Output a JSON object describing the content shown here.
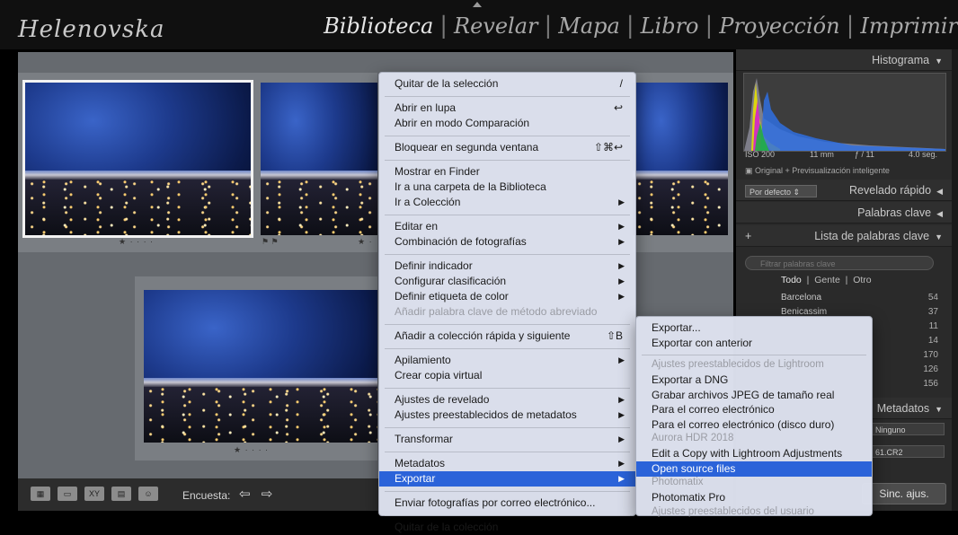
{
  "app": {
    "brand": "Helenovska",
    "modules": [
      "Biblioteca",
      "Revelar",
      "Mapa",
      "Libro",
      "Proyección",
      "Imprimir"
    ],
    "active_module": "Biblioteca"
  },
  "grid": {
    "photos": [
      {
        "rating": "★ · · · ·",
        "selected": true
      },
      {
        "flags": "⚑ ⚑",
        "rating": ""
      },
      {
        "rating": "★ · · · ·"
      },
      {
        "rating": "★ · · · ·"
      }
    ]
  },
  "toolbar": {
    "survey_label": "Encuesta:",
    "prev_next": "⇦ ⇨",
    "view_icons": [
      "▦",
      "▭",
      "XY",
      "▤",
      "☺"
    ]
  },
  "right_panel": {
    "histogram": {
      "title": "Histograma",
      "iso": "ISO 200",
      "focal": "11 mm",
      "aperture": "ƒ / 11",
      "shutter": "4.0 seg.",
      "original_preview": "Original + Previsualización inteligente"
    },
    "quick_develop": {
      "preset": "Por defecto",
      "title": "Revelado rápido"
    },
    "keywording_title": "Palabras clave",
    "keyword_list": {
      "title": "Lista de palabras clave",
      "add": "+",
      "filter_placeholder": "Filtrar palabras clave",
      "tabs": [
        "Todo",
        "Gente",
        "Otro"
      ],
      "rows": [
        {
          "name": "Barcelona",
          "count": "54"
        },
        {
          "name": "Benicassim",
          "count": "37"
        },
        {
          "name": "",
          "count": "11"
        },
        {
          "name": "",
          "count": "14"
        },
        {
          "name": "",
          "count": "170"
        },
        {
          "name": "",
          "count": "126"
        },
        {
          "name": "",
          "count": "156"
        }
      ]
    },
    "metadata": {
      "title": "Metadatos",
      "preset": "Ninguno",
      "file": "61.CR2"
    },
    "sync_button": "Sinc. ajus."
  },
  "context_menu": {
    "items": [
      {
        "label": "Quitar de la selección",
        "shortcut": "/"
      },
      {
        "sep": true
      },
      {
        "label": "Abrir en lupa",
        "shortcut": "↩"
      },
      {
        "label": "Abrir en modo Comparación"
      },
      {
        "sep": true
      },
      {
        "label": "Bloquear en segunda ventana",
        "shortcut": "⇧⌘↩"
      },
      {
        "sep": true
      },
      {
        "label": "Mostrar en Finder"
      },
      {
        "label": "Ir a una carpeta de la Biblioteca"
      },
      {
        "label": "Ir a Colección",
        "submenu": true
      },
      {
        "sep": true
      },
      {
        "label": "Editar en",
        "submenu": true
      },
      {
        "label": "Combinación de fotografías",
        "submenu": true
      },
      {
        "sep": true
      },
      {
        "label": "Definir indicador",
        "submenu": true
      },
      {
        "label": "Configurar clasificación",
        "submenu": true
      },
      {
        "label": "Definir etiqueta de color",
        "submenu": true
      },
      {
        "label": "Añadir palabra clave de método abreviado",
        "disabled": true
      },
      {
        "sep": true
      },
      {
        "label": "Añadir a colección rápida y siguiente",
        "shortcut": "⇧B"
      },
      {
        "sep": true
      },
      {
        "label": "Apilamiento",
        "submenu": true
      },
      {
        "label": "Crear copia virtual"
      },
      {
        "sep": true
      },
      {
        "label": "Ajustes de revelado",
        "submenu": true
      },
      {
        "label": "Ajustes preestablecidos de metadatos",
        "submenu": true
      },
      {
        "sep": true
      },
      {
        "label": "Transformar",
        "submenu": true
      },
      {
        "sep": true
      },
      {
        "label": "Metadatos",
        "submenu": true
      },
      {
        "label": "Exportar",
        "submenu": true,
        "highlighted": true
      },
      {
        "sep": true
      },
      {
        "label": "Enviar fotografías por correo electrónico..."
      },
      {
        "sep": true
      },
      {
        "label": "Quitar de la colección"
      }
    ]
  },
  "export_submenu": {
    "items": [
      {
        "label": "Exportar..."
      },
      {
        "label": "Exportar con anterior"
      },
      {
        "sep": true
      },
      {
        "header": "Ajustes preestablecidos de Lightroom"
      },
      {
        "label": "Exportar a DNG"
      },
      {
        "label": "Grabar archivos JPEG de tamaño real"
      },
      {
        "label": "Para el correo electrónico"
      },
      {
        "label": "Para el correo electrónico (disco duro)"
      },
      {
        "header": "Aurora HDR 2018"
      },
      {
        "label": "Edit a Copy with Lightroom Adjustments"
      },
      {
        "label": "Open source files",
        "highlighted": true
      },
      {
        "header": "Photomatix"
      },
      {
        "label": "Photomatix Pro"
      },
      {
        "header": "Ajustes preestablecidos del usuario"
      }
    ]
  }
}
